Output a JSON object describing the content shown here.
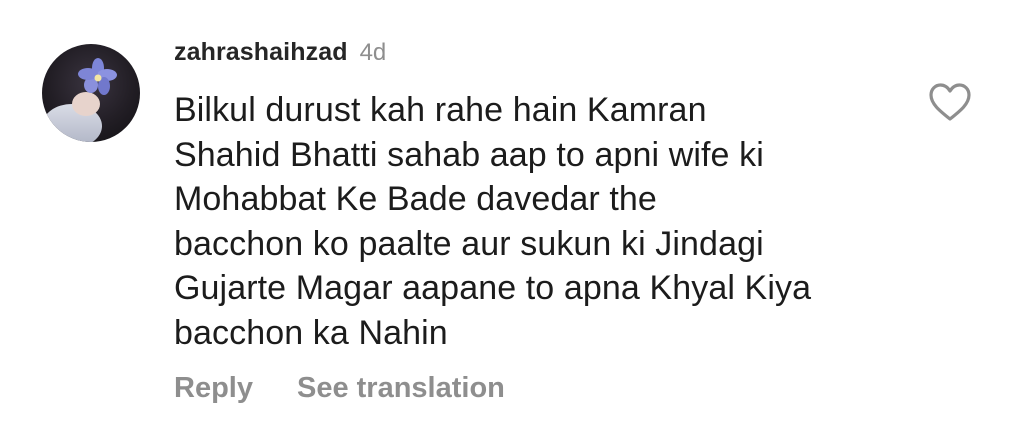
{
  "comment": {
    "username": "zahrashaihzad",
    "timestamp": "4d",
    "lines": [
      "Bilkul durust kah rahe hain Kamran",
      "Shahid Bhatti sahab aap to apni wife ki",
      "Mohabbat Ke Bade davedar the",
      "bacchon ko paalte aur sukun ki Jindagi",
      "Gujarte Magar aapane to apna Khyal Kiya",
      "bacchon ka Nahin"
    ],
    "actions": {
      "reply": "Reply",
      "see_translation": "See translation"
    },
    "icons": {
      "like": "heart-outline-icon",
      "avatar": "profile-photo"
    }
  },
  "colors": {
    "text": "#1c1c1c",
    "username": "#262626",
    "muted": "#8e8e8e"
  }
}
